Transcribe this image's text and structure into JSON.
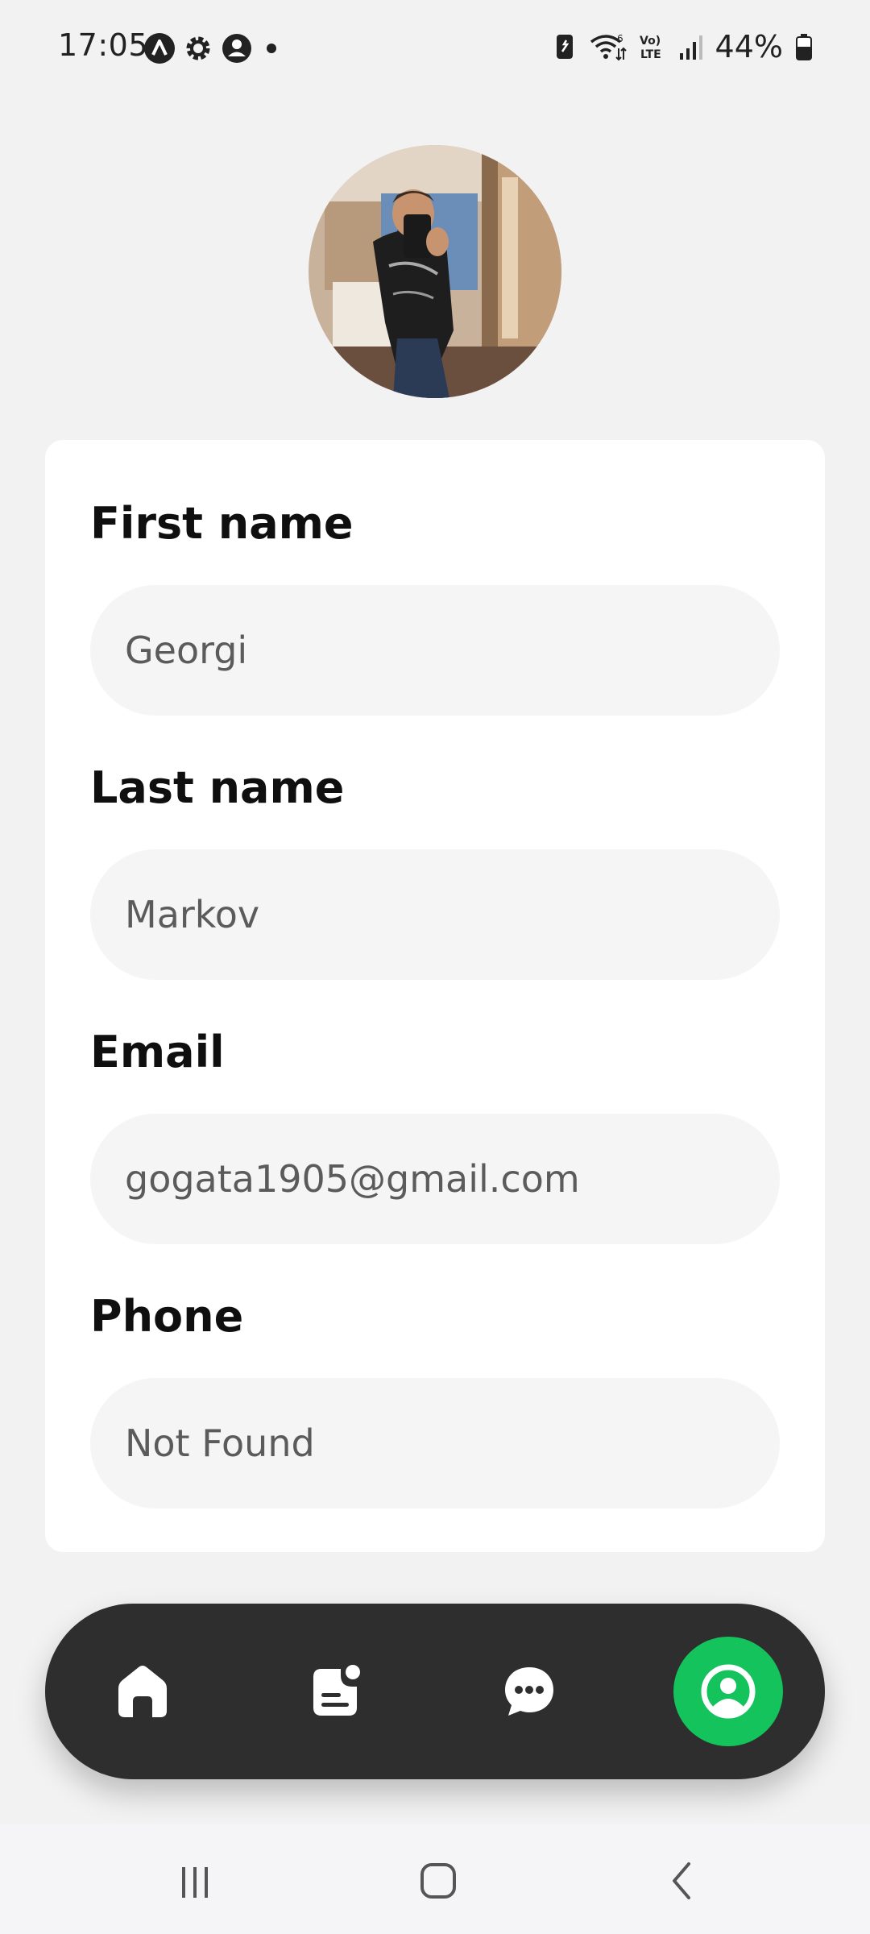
{
  "status_bar": {
    "time": "17:05",
    "battery": "44%",
    "left_icons": [
      "app-a-icon",
      "settings-icon",
      "account-icon",
      "dot-icon"
    ],
    "right_icons": [
      "battery-saver-icon",
      "wifi-6-icon",
      "volte-icon",
      "signal-icon",
      "battery-icon"
    ]
  },
  "profile": {
    "avatar": "avatar"
  },
  "form": {
    "first_name": {
      "label": "First name",
      "value": "Georgi"
    },
    "last_name": {
      "label": "Last name",
      "value": "Markov"
    },
    "email": {
      "label": "Email",
      "value": "gogata1905@gmail.com"
    },
    "phone": {
      "label": "Phone",
      "value": "Not Found"
    }
  },
  "bottom_nav": {
    "items": [
      {
        "icon": "home-icon"
      },
      {
        "icon": "news-icon"
      },
      {
        "icon": "chat-icon"
      },
      {
        "icon": "profile-icon",
        "active": true
      }
    ],
    "active_color": "#14c35c",
    "bar_color": "#2e2e2e"
  },
  "system_nav": {
    "icons": [
      "recents-icon",
      "home-button-icon",
      "back-icon"
    ]
  }
}
